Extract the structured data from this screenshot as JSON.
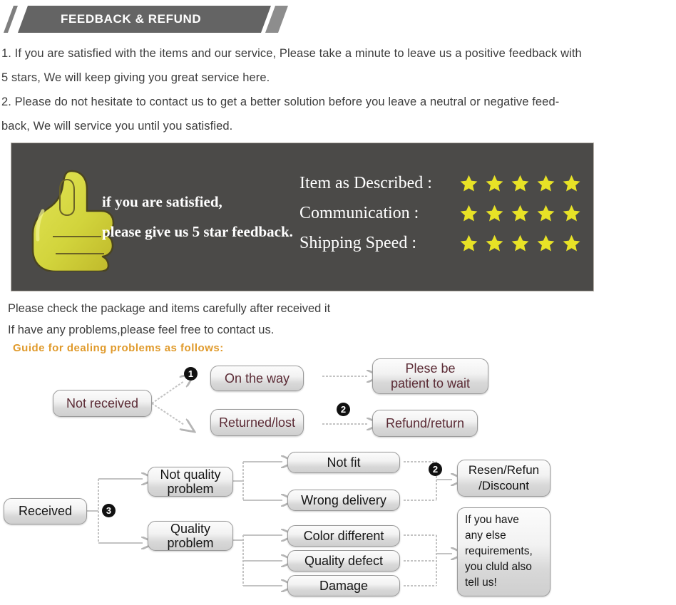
{
  "header": {
    "title": "FEEDBACK & REFUND",
    "bar_color": "#646464",
    "tail_color": "#8d8d8d"
  },
  "intro": {
    "lines": [
      "1. If you are satisfied with the items and our service, Please take a minute to leave us a positive feedback with",
      "5 stars, We will keep giving you great service here.",
      "2. Please do not hesitate to contact us to get a better solution before you leave a neutral or negative feed-",
      "back, We will service you until you satisfied."
    ]
  },
  "feedback_banner": {
    "background_color": "#4b4a48",
    "thumb_icon": "thumbs-up-icon",
    "thumb_color": "#d4d63e",
    "message_lines": [
      "if you are satisfied,",
      "please give us 5 star feedback."
    ],
    "star_color": "#e8e226",
    "ratings": [
      {
        "label": "Item as Described :",
        "stars": 5
      },
      {
        "label": "Communication :",
        "stars": 5
      },
      {
        "label": "Shipping Speed :",
        "stars": 5
      }
    ]
  },
  "mid_text": {
    "lines": [
      "Please check the package and items carefully after received it",
      "If have any problems,please feel free to contact us."
    ],
    "guide_note": "Guide for dealing problems as follows:",
    "guide_note_color": "#e09a2b"
  },
  "flowchart_one": {
    "root": "Not received",
    "badges": [
      {
        "number": "1"
      },
      {
        "number": "2"
      }
    ],
    "branches": [
      {
        "cause": "On the way",
        "result": "Plese be\npatient to wait",
        "cause_line1": "On the way",
        "result_line1": "Plese be",
        "result_line2": "patient to wait"
      },
      {
        "cause": "Returned/lost",
        "result": "Refund/return",
        "cause_line1": "Returned/lost",
        "result_line1": "Refund/return",
        "result_line2": ""
      }
    ]
  },
  "flowchart_two": {
    "root": "Received",
    "badges": [
      {
        "number": "3"
      },
      {
        "number": "2"
      }
    ],
    "categories": [
      {
        "line1": "Not quality",
        "line2": "problem"
      },
      {
        "line1": "Quality",
        "line2": "problem"
      }
    ],
    "issues": [
      "Not fit",
      "Wrong delivery",
      "Color different",
      "Quality defect",
      "Damage"
    ],
    "outcomes": [
      {
        "line1": "Resen/Refun",
        "line2": "/Discount"
      }
    ],
    "note_lines": [
      "If you have",
      "any else",
      "requirements,",
      "you cluld also",
      "tell us!"
    ]
  }
}
